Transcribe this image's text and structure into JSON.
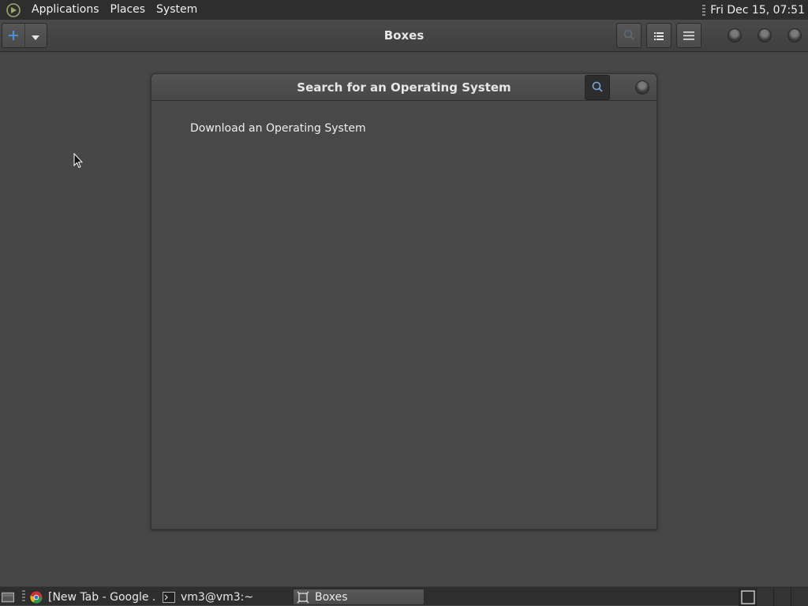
{
  "top_panel": {
    "menus": [
      "Applications",
      "Places",
      "System"
    ],
    "clock": "Fri Dec 15, 07:51"
  },
  "headerbar": {
    "title": "Boxes",
    "new_button_icon": "plus-icon",
    "dropdown_icon": "chevron-down-icon",
    "buttons": [
      "search-icon",
      "list-view-icon",
      "menu-icon"
    ],
    "window_controls": [
      "minimize-icon",
      "maximize-icon",
      "close-icon"
    ]
  },
  "dialog": {
    "title": "Search for an Operating System",
    "search_icon": "search-icon",
    "close_icon": "close-icon",
    "download_link": "Download an Operating System"
  },
  "taskbar": {
    "items": [
      {
        "label": "[New Tab - Google ...",
        "icon": "chrome-icon"
      },
      {
        "label": "vm3@vm3:~",
        "icon": "terminal-icon"
      },
      {
        "label": "Boxes",
        "icon": "boxes-icon",
        "active": true
      }
    ]
  },
  "colors": {
    "background": "#474747",
    "panel": "#2e2e2e",
    "accent": "#4a90d9",
    "text": "#eeeeec"
  }
}
